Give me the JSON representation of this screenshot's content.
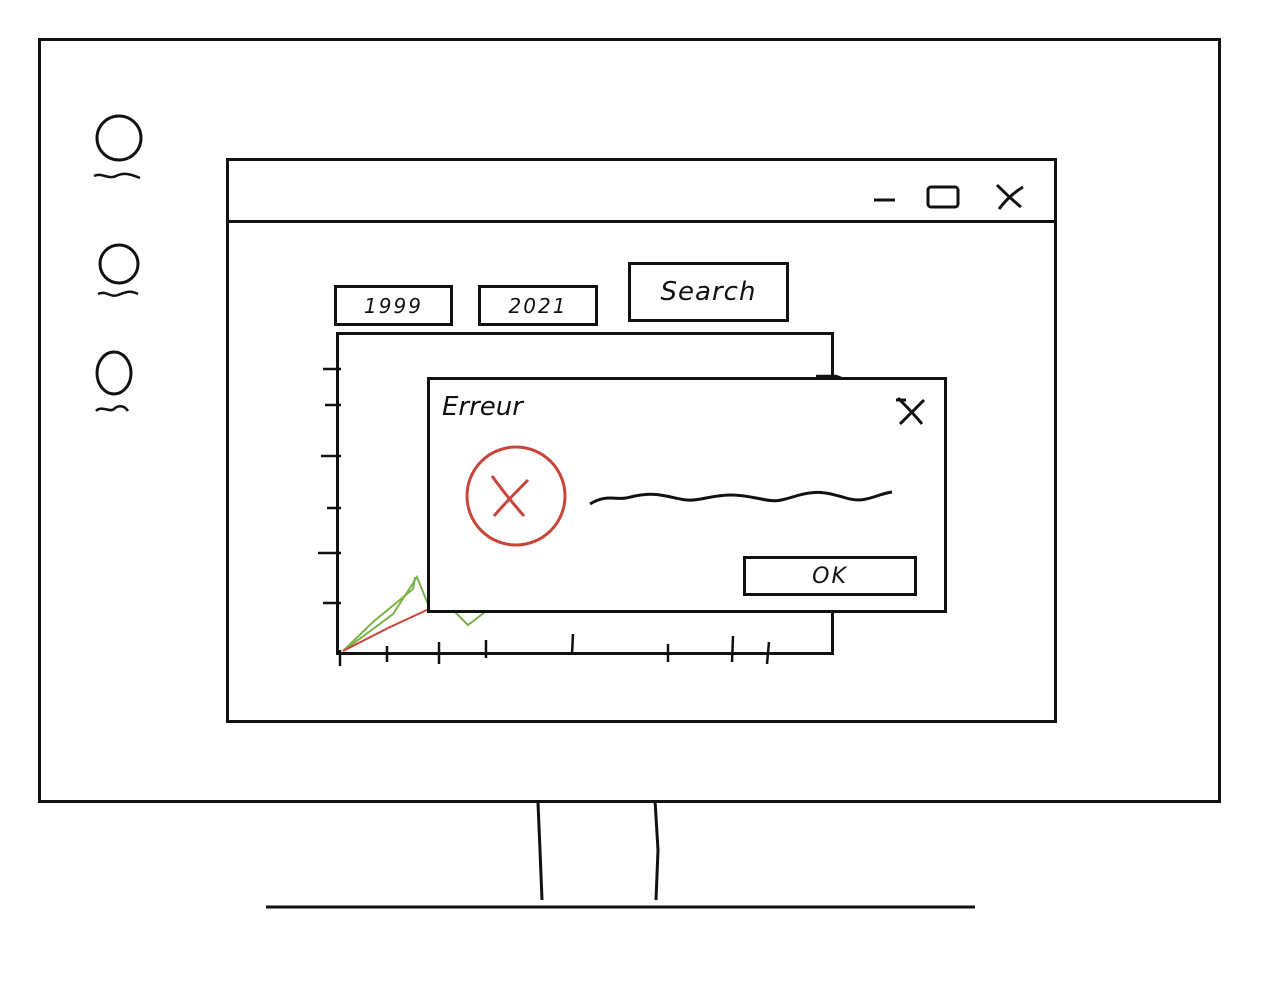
{
  "desktop": {
    "icons": [
      {
        "name": "app-icon-1"
      },
      {
        "name": "app-icon-2"
      },
      {
        "name": "app-icon-3"
      }
    ]
  },
  "window": {
    "controls": {
      "minimize_icon": "minimize-icon",
      "maximize_icon": "maximize-icon",
      "close_icon": "close-icon"
    },
    "filters": {
      "start_year": "1999",
      "end_year": "2021",
      "search_label": "Search"
    }
  },
  "chart_data": {
    "type": "line",
    "series": [
      {
        "color": "#7db24a"
      },
      {
        "color": "#c9443a"
      }
    ]
  },
  "dialog": {
    "title": "Erreur",
    "close_icon": "close-icon",
    "error_icon": "error-icon",
    "error_color": "#c9443a",
    "ok_label": "OK"
  }
}
